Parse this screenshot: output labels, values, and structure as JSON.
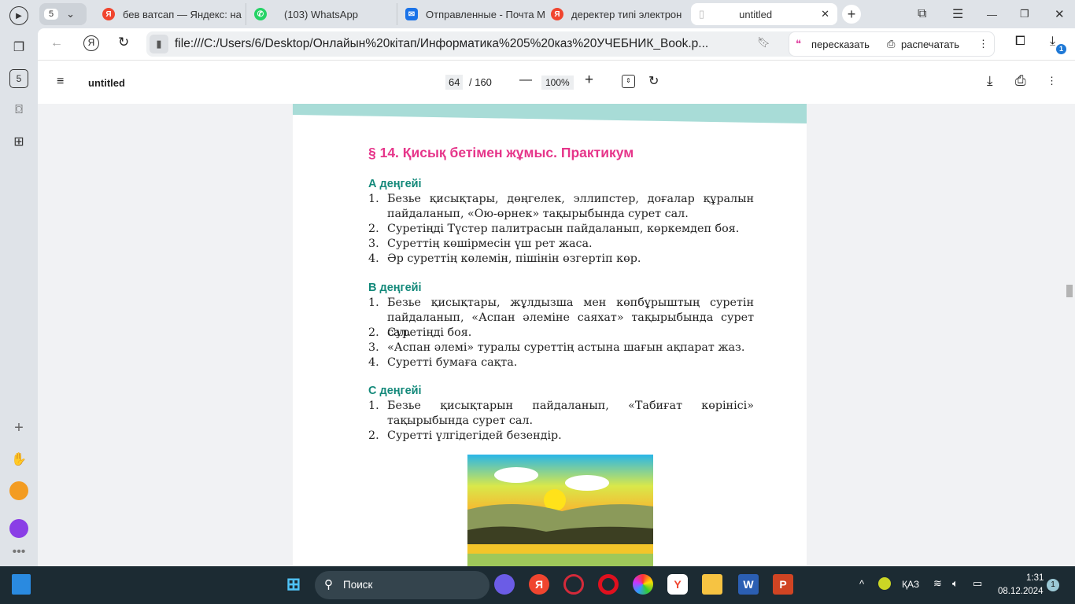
{
  "browser": {
    "tab_count": "5",
    "tabs": [
      {
        "title": "бев ватсап — Яндекс: на",
        "icon": "yandex-icon"
      },
      {
        "title": "(103) WhatsApp",
        "icon": "whatsapp-icon"
      },
      {
        "title": "Отправленные - Почта M",
        "icon": "mail-icon"
      },
      {
        "title": "деректер типі электрон",
        "icon": "yandex-icon"
      },
      {
        "title": "untitled",
        "icon": "pdf-icon",
        "active": true
      }
    ],
    "url": "file:///C:/Users/6/Desktop/Онлайын%20кітап/Информатика%205%20каз%20УЧЕБНИК_Book.p...",
    "retell_label": "пересказать",
    "print_label": "распечатать",
    "downloads_badge": "1",
    "sidebar_badge": "5"
  },
  "pdf": {
    "title": "untitled",
    "page": "64",
    "total": "/ 160",
    "zoom": "100%"
  },
  "doc": {
    "title": "§ 14. Қисық бетімен жұмыс. Практикум",
    "sections": [
      {
        "heading": "А деңгейі",
        "items": [
          {
            "n": "1.",
            "t": "Безье қисықтары, дөңгелек, эллипстер, доғалар құралын пайдаланып, «Ою-өрнек» тақырыбында сурет сал."
          },
          {
            "n": "2.",
            "t": "Суретіңді Түстер палитрасын пайдаланып, көркемдеп боя."
          },
          {
            "n": "3.",
            "t": "Суреттің көшірмесін үш рет жаса."
          },
          {
            "n": "4.",
            "t": "Әр суреттің көлемін, пішінін өзгертіп көр."
          }
        ]
      },
      {
        "heading": "В деңгейі",
        "items": [
          {
            "n": "1.",
            "t": "Безье қисықтары, жұлдызша мен көпбұрыштың суретін пайдаланып, «Аспан әлеміне саяхат» тақырыбында сурет сал."
          },
          {
            "n": "2.",
            "t": "Суретіңді боя."
          },
          {
            "n": "3.",
            "t": "«Аспан әлемі» туралы суреттің астына шағын ақпарат жаз."
          },
          {
            "n": "4.",
            "t": "Суретті бумаға сақта."
          }
        ]
      },
      {
        "heading": "С деңгейі",
        "items": [
          {
            "n": "1.",
            "t": "Безье қисықтарын пайдаланып, «Табиғат көрінісі» тақырыбында сурет сал."
          },
          {
            "n": "2.",
            "t": "Суретті үлгідегідей безендір."
          }
        ]
      }
    ]
  },
  "taskbar": {
    "search": "Поиск",
    "lang": "ҚАЗ",
    "time": "1:31",
    "date": "08.12.2024",
    "notif": "1"
  },
  "colors": {
    "title": "#e6358a",
    "heading": "#13897a",
    "strip": "#a8dcd7"
  }
}
